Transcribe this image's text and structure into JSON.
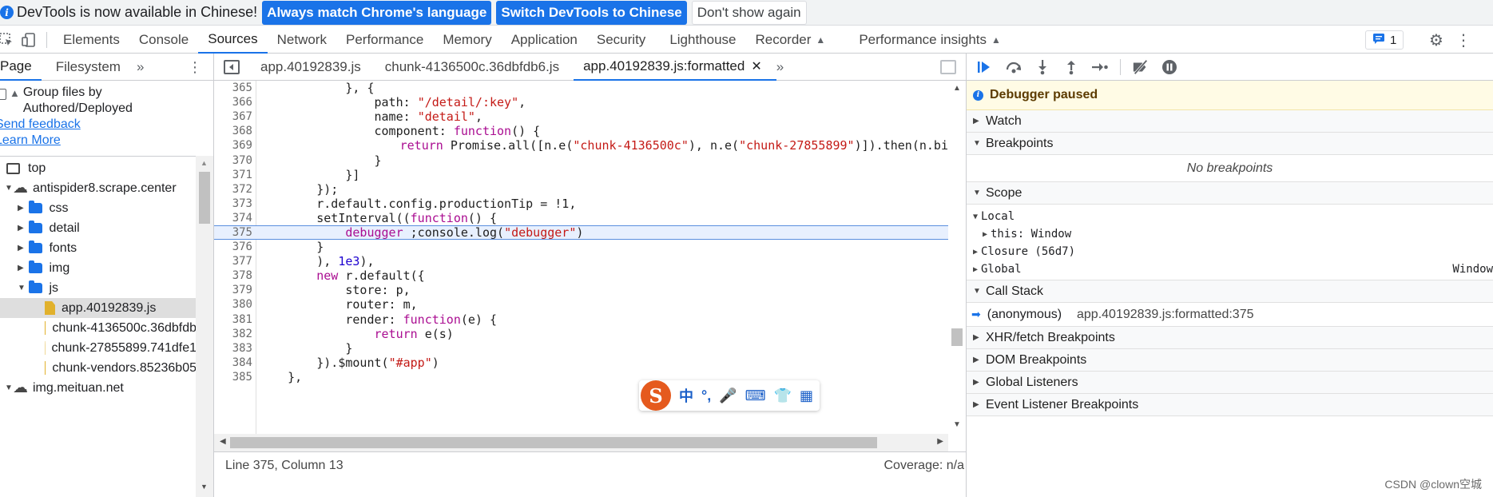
{
  "infobar": {
    "message": "DevTools is now available in Chinese!",
    "btn_match": "Always match Chrome's language",
    "btn_switch": "Switch DevTools to Chinese",
    "btn_dismiss": "Don't show again"
  },
  "main_tabs": [
    "Elements",
    "Console",
    "Sources",
    "Network",
    "Performance",
    "Memory",
    "Application",
    "Security",
    "Lighthouse",
    "Recorder",
    "Performance insights"
  ],
  "main_tab_active": "Sources",
  "issues_count": "1",
  "navigator": {
    "tabs": [
      "Page",
      "Filesystem"
    ],
    "group_label_1": "Group files by",
    "group_label_2": "Authored/Deployed",
    "send_feedback": "Send feedback",
    "learn_more": "Learn More",
    "tree": [
      {
        "label": "top",
        "type": "frame"
      },
      {
        "label": "antispider8.scrape.center",
        "type": "domain"
      },
      {
        "label": "css",
        "type": "folder"
      },
      {
        "label": "detail",
        "type": "folder"
      },
      {
        "label": "fonts",
        "type": "folder"
      },
      {
        "label": "img",
        "type": "folder"
      },
      {
        "label": "js",
        "type": "folder-open"
      },
      {
        "label": "app.40192839.js",
        "type": "file",
        "selected": true
      },
      {
        "label": "chunk-4136500c.36dbfdb",
        "type": "file"
      },
      {
        "label": "chunk-27855899.741dfe1",
        "type": "file"
      },
      {
        "label": "chunk-vendors.85236b05",
        "type": "file"
      },
      {
        "label": "img.meituan.net",
        "type": "domain"
      }
    ]
  },
  "editor": {
    "tabs": [
      "app.40192839.js",
      "chunk-4136500c.36dbfdb6.js",
      "app.40192839.js:formatted"
    ],
    "active_tab": "app.40192839.js:formatted",
    "lines": [
      {
        "n": "365",
        "code": "            }, {"
      },
      {
        "n": "366",
        "code": "                path: \"/detail/:key\","
      },
      {
        "n": "367",
        "code": "                name: \"detail\","
      },
      {
        "n": "368",
        "code": "                component: function() {"
      },
      {
        "n": "369",
        "code": "                    return Promise.all([n.e(\"chunk-4136500c\"), n.e(\"chunk-27855899\")]).then(n.bind(null,"
      },
      {
        "n": "370",
        "code": "                }"
      },
      {
        "n": "371",
        "code": "            }]"
      },
      {
        "n": "372",
        "code": "        });"
      },
      {
        "n": "373",
        "code": "        r.default.config.productionTip = !1,"
      },
      {
        "n": "374",
        "code": "        setInterval((function() {"
      },
      {
        "n": "375",
        "code": "            debugger ;console.log(\"debugger\")"
      },
      {
        "n": "376",
        "code": "        }"
      },
      {
        "n": "377",
        "code": "        ), 1e3),"
      },
      {
        "n": "378",
        "code": "        new r.default({"
      },
      {
        "n": "379",
        "code": "            store: p,"
      },
      {
        "n": "380",
        "code": "            router: m,"
      },
      {
        "n": "381",
        "code": "            render: function(e) {"
      },
      {
        "n": "382",
        "code": "                return e(s)"
      },
      {
        "n": "383",
        "code": "            }"
      },
      {
        "n": "384",
        "code": "        }).$mount(\"#app\")"
      },
      {
        "n": "385",
        "code": "    },"
      }
    ],
    "paused_line": "375",
    "status_position": "Line 375, Column 13",
    "status_coverage": "Coverage: n/a"
  },
  "debugger": {
    "paused_text": "Debugger paused",
    "watch": "Watch",
    "breakpoints": "Breakpoints",
    "no_breakpoints": "No breakpoints",
    "scope": "Scope",
    "local": "Local",
    "this_key": "this",
    "this_val": "Window",
    "closure": "Closure (56d7)",
    "global": "Global",
    "global_val": "Window",
    "call_stack": "Call Stack",
    "frame_name": "(anonymous)",
    "frame_loc": "app.40192839.js:formatted:375",
    "xhr": "XHR/fetch Breakpoints",
    "dom": "DOM Breakpoints",
    "listeners": "Global Listeners",
    "event_listeners": "Event Listener Breakpoints"
  },
  "ime": {
    "logo": "S",
    "items": [
      "中",
      "°,",
      "🎤",
      "⌨",
      "👕",
      "▦"
    ]
  },
  "watermark": "CSDN @clown空城"
}
